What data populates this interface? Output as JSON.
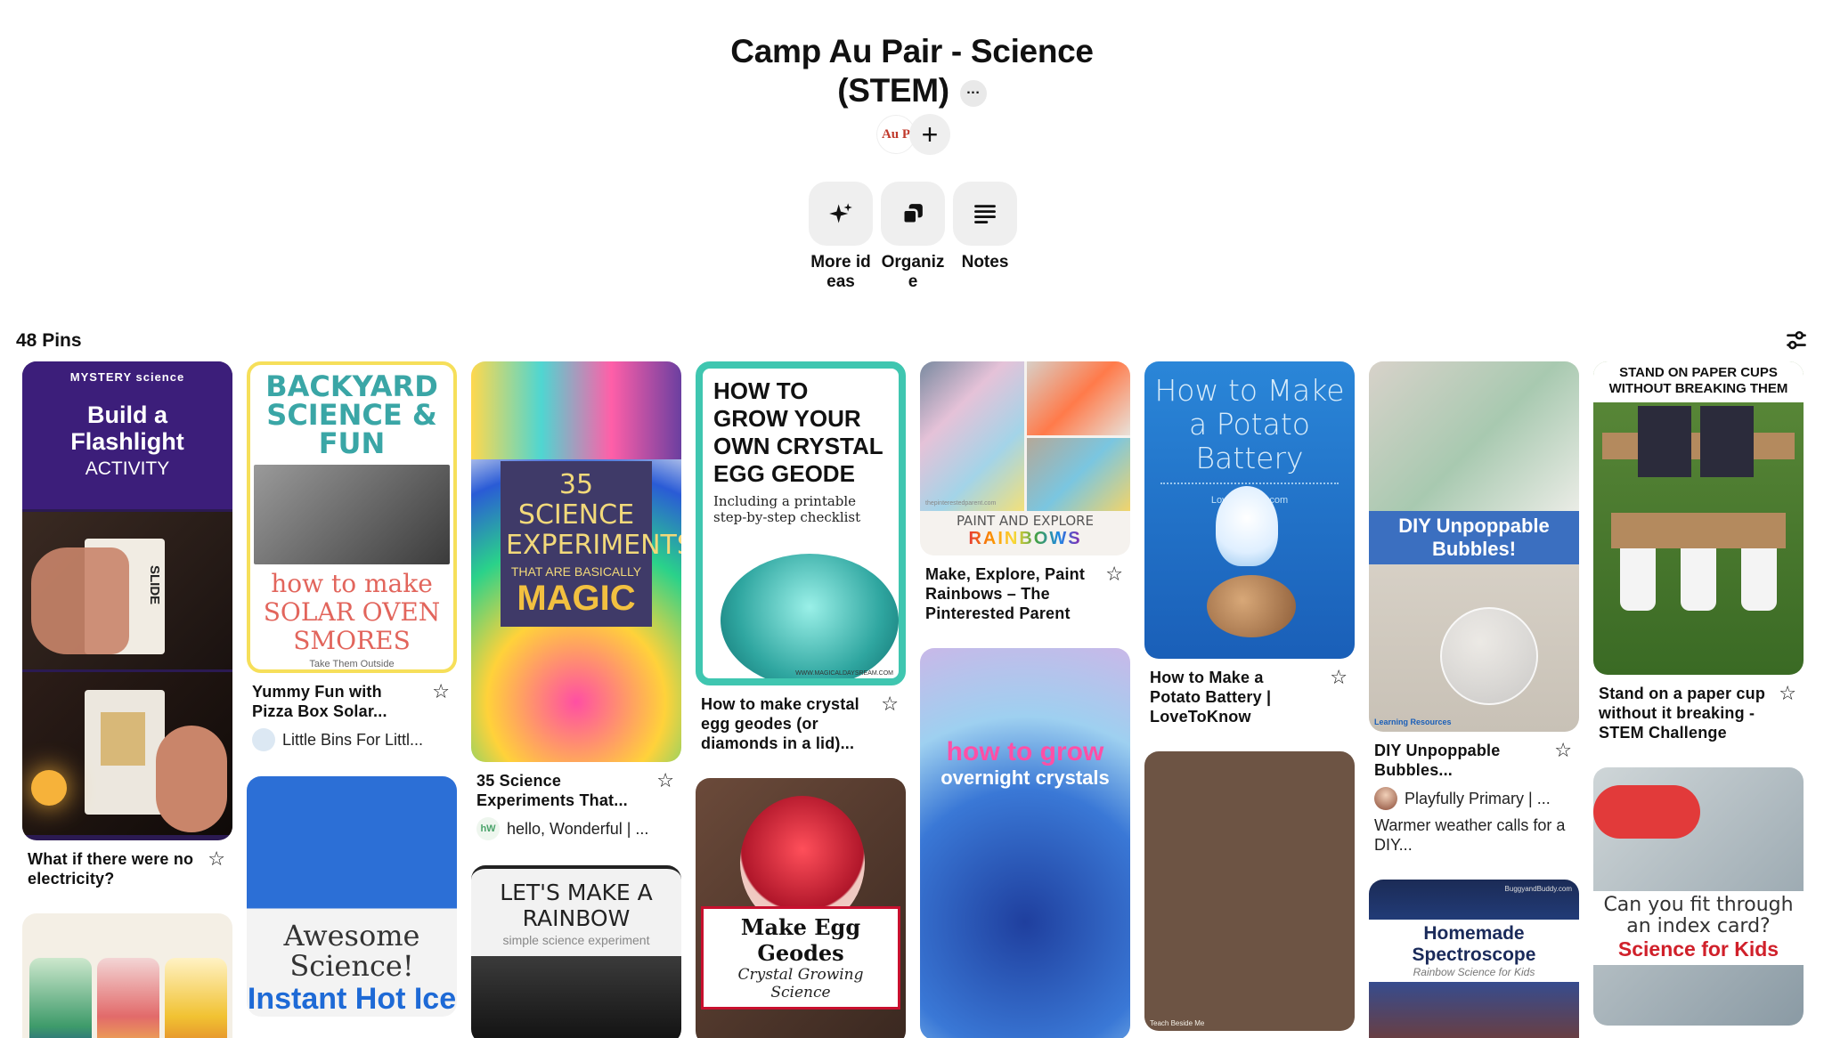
{
  "board": {
    "title_line1": "Camp Au Pair - Science",
    "title_line2": "(STEM)",
    "more_label": "···",
    "avatar_text": "Au P",
    "add_label": "+"
  },
  "actions": [
    {
      "label": "More ideas",
      "icon": "sparkle-icon"
    },
    {
      "label": "Organize",
      "icon": "organize-icon"
    },
    {
      "label": "Notes",
      "icon": "notes-icon"
    }
  ],
  "pins_count": "48 Pins",
  "pins": {
    "c1": [
      {
        "title": "What if there were no electricity?",
        "thumb": {
          "top": "MYSTERY science",
          "main": "Build a Flashlight",
          "sub": "ACTIVITY",
          "tag": "SLIDE"
        }
      },
      {
        "title": "",
        "thumb": {}
      }
    ],
    "c2": [
      {
        "title": "Yummy Fun with Pizza Box Solar...",
        "source": "Little Bins For Littl...",
        "thumb": {
          "top": "BACKYARD SCIENCE & FUN",
          "main": "how to make SOLAR OVEN SMORES",
          "sub": "Take Them Outside"
        }
      },
      {
        "title": "",
        "thumb": {
          "main": "Awesome Science!",
          "sub": "Instant Hot Ice"
        }
      }
    ],
    "c3": [
      {
        "title": "35 Science Experiments That...",
        "source": "hello, Wonderful | ...",
        "src_logo": "hW",
        "thumb": {
          "main": "35 SCIENCE EXPERIMENTS",
          "sub": "THAT ARE BASICALLY",
          "tag": "MAGIC"
        }
      },
      {
        "title": "",
        "thumb": {
          "main": "LET'S MAKE A RAINBOW",
          "sub": "simple science experiment"
        }
      }
    ],
    "c4": [
      {
        "title": "How to make crystal egg geodes (or diamonds in a lid)...",
        "thumb": {
          "main": "HOW TO GROW YOUR OWN CRYSTAL EGG GEODE",
          "sub": "Including a printable step-by-step checklist",
          "tag": "WWW.MAGICALDAYSREAM.COM"
        }
      },
      {
        "title": "",
        "thumb": {
          "main": "Make Egg Geodes",
          "sub": "Crystal Growing Science"
        }
      }
    ],
    "c5": [
      {
        "title": "Make, Explore, Paint Rainbows – The Pinterested Parent",
        "thumb": {
          "main": "PAINT AND EXPLORE",
          "sub": "RAINBOWS",
          "tag": "thepinterestedparent.com"
        }
      },
      {
        "title": "",
        "thumb": {
          "main": "how to grow",
          "sub": "overnight crystals"
        }
      }
    ],
    "c6": [
      {
        "title": "How to Make a Potato Battery | LoveToKnow",
        "thumb": {
          "main": "How to Make a Potato Battery",
          "sub": "LoveToKnow.com"
        }
      },
      {
        "title": "",
        "thumb": {
          "tag": "Teach Beside Me"
        }
      }
    ],
    "c7": [
      {
        "title": "DIY Unpoppable Bubbles...",
        "source": "Playfully Primary | ...",
        "description": "Warmer weather calls for a DIY...",
        "thumb": {
          "main": "DIY Unpoppable Bubbles!",
          "tag": "Learning Resources"
        }
      },
      {
        "title": "",
        "thumb": {
          "main": "Homemade Spectroscope",
          "sub": "Rainbow Science for Kids",
          "tag": "BuggyandBuddy.com"
        }
      }
    ],
    "c8": [
      {
        "title": "Stand on a paper cup without it breaking - STEM Challenge",
        "thumb": {
          "main": "STAND ON PAPER CUPS WITHOUT BREAKING THEM"
        }
      },
      {
        "title": "",
        "thumb": {
          "main": "Can you fit through an index card?",
          "sub": "Science for Kids"
        }
      }
    ]
  },
  "colors": {
    "text": "#111111",
    "button_bg": "#efefef",
    "accent_purple": "#3b1f75"
  }
}
